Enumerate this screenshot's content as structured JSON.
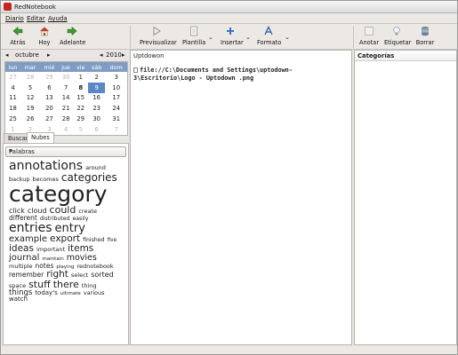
{
  "window": {
    "title": "RedNotebook"
  },
  "menu": {
    "items": [
      "Diario",
      "Editar",
      "Ayuda"
    ]
  },
  "toolbar": {
    "back_label": "Atrás",
    "today_label": "Hoy",
    "forward_label": "Adelante",
    "preview_label": "Previsualizar",
    "template_label": "Plantilla",
    "insert_label": "Insertar",
    "format_label": "Formato",
    "annotate_label": "Anotar",
    "tag_label": "Etiquetar",
    "clear_label": "Borrar"
  },
  "calendar": {
    "month": "octubre",
    "year": "2010",
    "weekdays": [
      "lun",
      "mar",
      "mié",
      "jue",
      "vie",
      "sáb",
      "dom"
    ],
    "weeks": [
      [
        "27",
        "28",
        "29",
        "30",
        "1",
        "2",
        "3"
      ],
      [
        "4",
        "5",
        "6",
        "7",
        "8",
        "9",
        "10"
      ],
      [
        "11",
        "12",
        "13",
        "14",
        "15",
        "16",
        "17"
      ],
      [
        "18",
        "19",
        "20",
        "21",
        "22",
        "23",
        "24"
      ],
      [
        "25",
        "26",
        "27",
        "28",
        "29",
        "30",
        "31"
      ],
      [
        "1",
        "2",
        "3",
        "4",
        "5",
        "6",
        "7"
      ]
    ],
    "selected_day": "9"
  },
  "tabs": {
    "search_label": "Buscar",
    "clouds_label": "Nubes"
  },
  "cloud": {
    "combo_value": "Palabras",
    "words": [
      {
        "t": "annotations",
        "s": 14
      },
      {
        "t": "around",
        "s": 6.5
      },
      {
        "t": "backup",
        "s": 6.5
      },
      {
        "t": "becomes",
        "s": 6.5
      },
      {
        "t": "categories",
        "s": 12
      },
      {
        "t": "category",
        "s": 25
      },
      {
        "t": "click",
        "s": 8
      },
      {
        "t": "cloud",
        "s": 8
      },
      {
        "t": "could",
        "s": 11
      },
      {
        "t": "create",
        "s": 6.5
      },
      {
        "t": "different",
        "s": 7.5
      },
      {
        "t": "distributed",
        "s": 6.2
      },
      {
        "t": "easily",
        "s": 6.2
      },
      {
        "t": "entries",
        "s": 14
      },
      {
        "t": "entry",
        "s": 13
      },
      {
        "t": "example",
        "s": 10
      },
      {
        "t": "export",
        "s": 10.5
      },
      {
        "t": "finished",
        "s": 6.2
      },
      {
        "t": "five",
        "s": 5.8
      },
      {
        "t": "ideas",
        "s": 10.5
      },
      {
        "t": "important",
        "s": 6.5
      },
      {
        "t": "items",
        "s": 10.5
      },
      {
        "t": "journal",
        "s": 10
      },
      {
        "t": "maintain",
        "s": 5.5
      },
      {
        "t": "movies",
        "s": 9.5
      },
      {
        "t": "multiple",
        "s": 6.5
      },
      {
        "t": "notes",
        "s": 7.5
      },
      {
        "t": "playing",
        "s": 5.5
      },
      {
        "t": "rednotebook",
        "s": 6.5
      },
      {
        "t": "remember",
        "s": 7.5
      },
      {
        "t": "right",
        "s": 10.5
      },
      {
        "t": "select",
        "s": 6.5
      },
      {
        "t": "sorted",
        "s": 8
      },
      {
        "t": "space",
        "s": 6.5
      },
      {
        "t": "stuff",
        "s": 11
      },
      {
        "t": "there",
        "s": 11
      },
      {
        "t": "thing",
        "s": 6.5
      },
      {
        "t": "things",
        "s": 8.5
      },
      {
        "t": "today's",
        "s": 7
      },
      {
        "t": "ultimate",
        "s": 5.5
      },
      {
        "t": "various",
        "s": 6.5
      },
      {
        "t": "watch",
        "s": 7
      }
    ]
  },
  "editor": {
    "date_tag": "Uptdowon",
    "file_link": "file://C:\\Documents and Settings\\uptodown-3\\Escritorio\\Logo - Uptodown .png"
  },
  "categories": {
    "header": "Categorías"
  }
}
